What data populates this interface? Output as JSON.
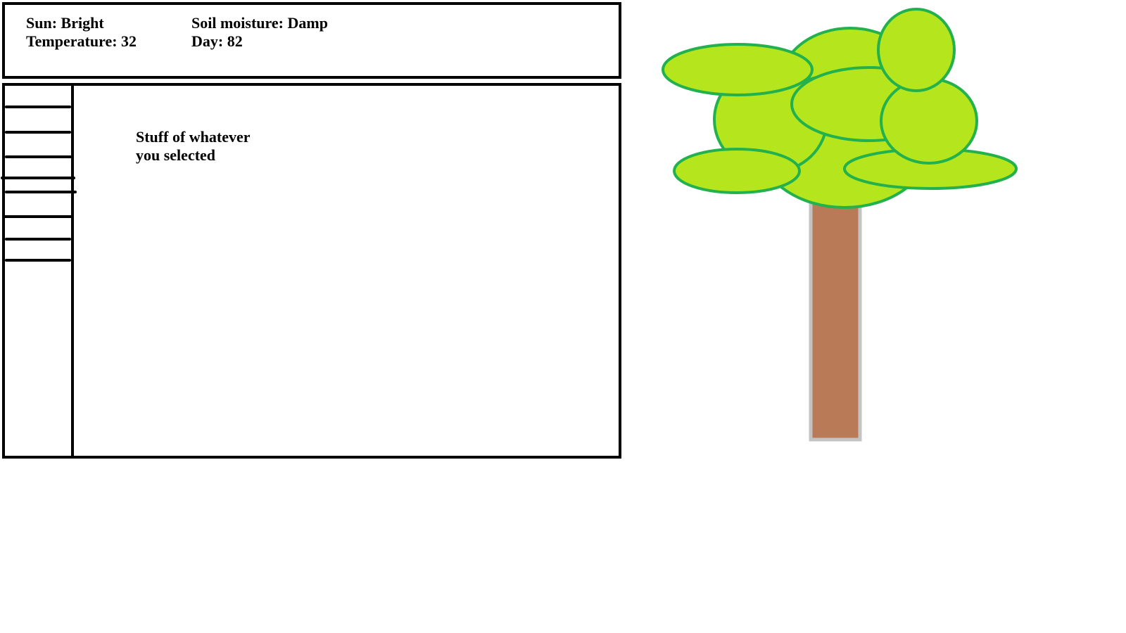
{
  "status": {
    "sun": "Sun: Bright",
    "temperature": "Temperature: 32",
    "soil_moisture": "Soil moisture: Damp",
    "day": "Day: 82"
  },
  "detail": {
    "line1": "Stuff of whatever",
    "line2": "you selected"
  },
  "colors": {
    "foliage_fill": "#b5e61d",
    "foliage_stroke": "#22b14c",
    "trunk_fill": "#b97a57",
    "trunk_stroke": "#c3c3c3",
    "border": "#000000"
  }
}
